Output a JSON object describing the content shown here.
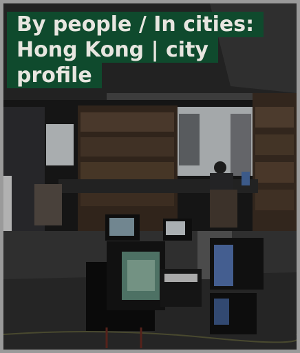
{
  "card": {
    "title_lines": [
      "By people / In cities:",
      "Hong Kong | city",
      "profile"
    ],
    "image_description": "Dim interior with bookshelves, windows and stacked CRT televisions",
    "colors": {
      "title_background": "#0f4a2d",
      "title_text": "#e8e6e0",
      "frame": "#9a9a9a"
    }
  }
}
